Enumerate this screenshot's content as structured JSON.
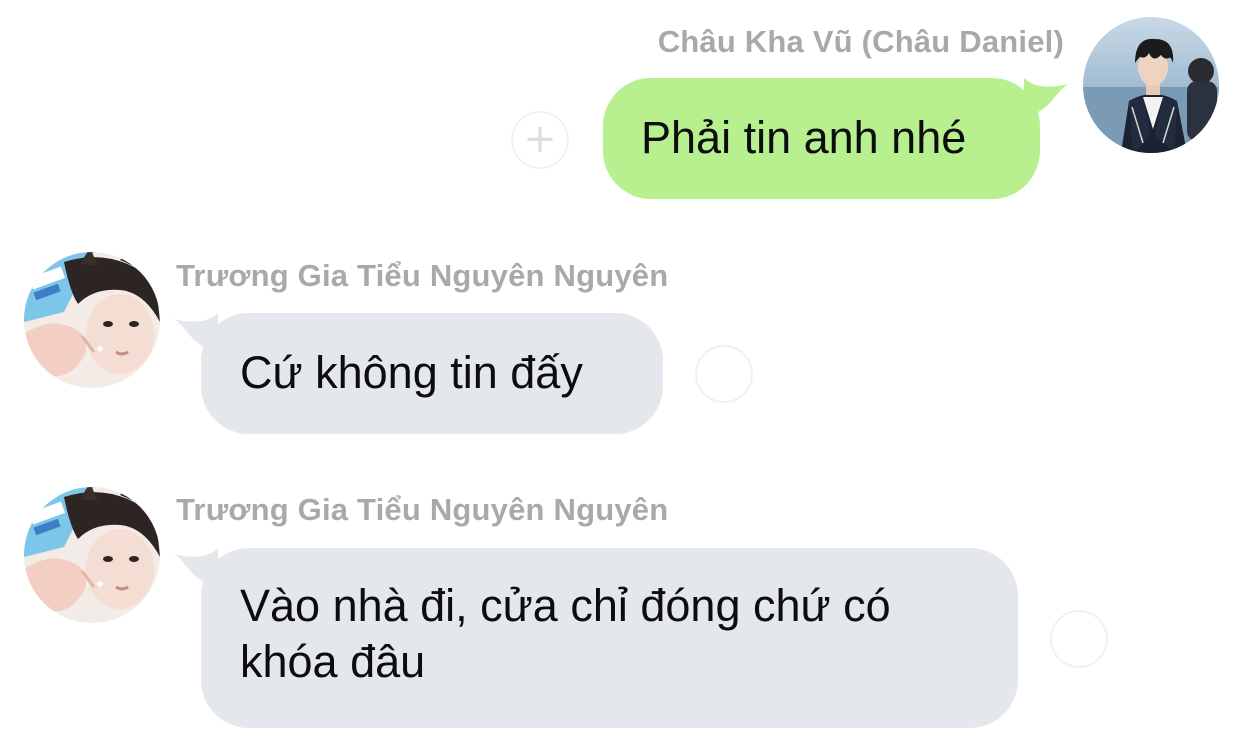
{
  "messages": [
    {
      "side": "right",
      "sender": "Châu Kha Vũ (Châu Daniel)",
      "text": "Phải tin anh nhé",
      "bubble_color": "#b8f08f",
      "avatar": "avatar-boy-dark-jacket"
    },
    {
      "side": "left",
      "sender": "Trương Gia Tiểu Nguyên Nguyên",
      "text": "Cứ không tin đấy",
      "bubble_color": "#e4e7ec",
      "avatar": "avatar-boy-waving"
    },
    {
      "side": "left",
      "sender": "Trương Gia Tiểu Nguyên Nguyên",
      "text_line1": "Vào nhà đi, cửa chỉ đóng chứ có",
      "text_line2": "khóa đâu",
      "bubble_color": "#e4e7ec",
      "avatar": "avatar-boy-waving"
    }
  ],
  "reaction_button": {
    "icon": "add-reaction-icon",
    "glyph": "+"
  },
  "colors": {
    "sender_name": "#a9a9ad",
    "text": "#0d0d0d",
    "background": "#ffffff"
  }
}
